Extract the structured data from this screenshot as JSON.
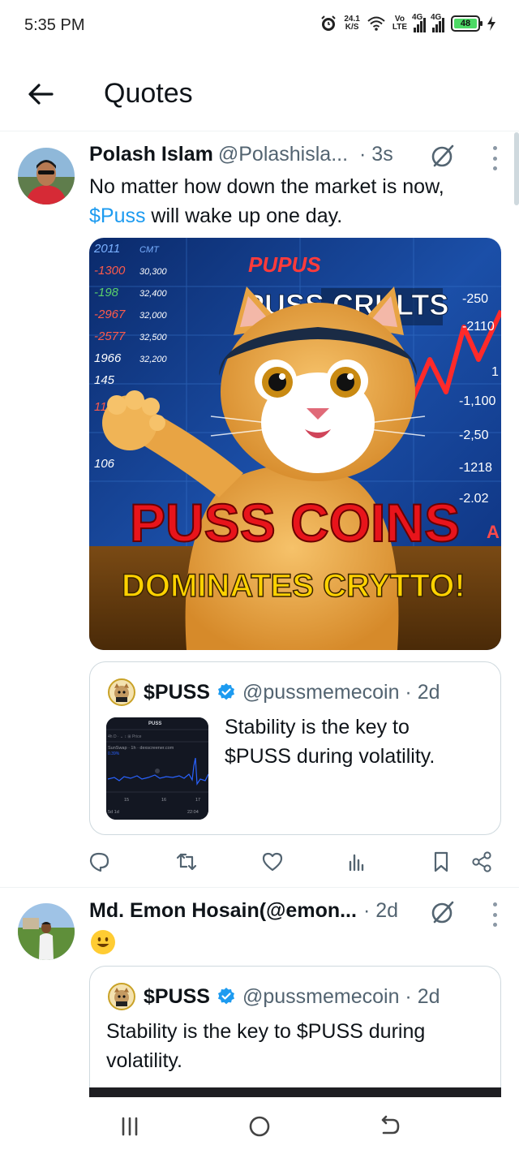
{
  "status_bar": {
    "time": "5:35 PM",
    "speed_value": "24.1",
    "speed_unit": "K/S",
    "volte_top": "Vo",
    "volte_bottom": "LTE",
    "net1": "4G",
    "net2": "4G",
    "battery": "48"
  },
  "header": {
    "title": "Quotes"
  },
  "tweet1": {
    "name": "Polash Islam",
    "handle": "@Polashisla...",
    "time": "· 3s",
    "text_line1": "No matter how down the market is now,",
    "cashtag": "$Puss",
    "text_line2_rest": " will wake up one day.",
    "image": {
      "top_label": "PUPUS",
      "banner": "PUSS CRULTS",
      "headline": "PUSS  COINS",
      "subline": "DOMINATES CRYTTO!",
      "left_ticker": [
        "2011",
        "-1300",
        "-198",
        "-2967",
        "-2577",
        "1966",
        "145",
        "116",
        "106"
      ],
      "left_ticker2": [
        "CMT",
        "30,300",
        "32,400",
        "32,000",
        "32,500",
        "32,200"
      ],
      "right_ticker": [
        "-250",
        "-2110",
        "1",
        "-1,100",
        "-2,50",
        "-1218",
        "-2.02",
        "A"
      ]
    },
    "quote": {
      "name": "$PUSS",
      "handle": "@pussmemecoin · 2d",
      "text_line1": "Stability is the key to",
      "text_line2": "$PUSS during volatility.",
      "thumb": {
        "title": "PUSS",
        "subtitle": "SunSwap · 1h · dexscreener.com",
        "change": "0.39%",
        "toolbar": "4h  D  ⋅ ⌄  ↕  ⊞  Price",
        "x_labels": [
          "15",
          "16",
          "17"
        ],
        "footer": "5d  1d",
        "clock": "22:04"
      }
    }
  },
  "tweet2": {
    "name": "Md. Emon Hosain(@emon...",
    "time": "· 2d",
    "emoji": "😀",
    "quote": {
      "name": "$PUSS",
      "handle": "@pussmemecoin · 2d",
      "text_line1": "Stability is the key to $PUSS during",
      "text_line2": "volatility."
    }
  },
  "icons": [
    "back-arrow-icon",
    "grok-icon",
    "more-icon",
    "reply-icon",
    "retweet-icon",
    "like-icon",
    "views-icon",
    "bookmark-icon",
    "share-icon",
    "verified-icon",
    "menu-icon",
    "home-icon",
    "back-nav-icon"
  ],
  "colors": {
    "accent": "#1d9bf0",
    "secondary_text": "#536471",
    "border": "#cfd9de",
    "headline_red": "#e8141b",
    "headline_yellow": "#ffd200"
  }
}
